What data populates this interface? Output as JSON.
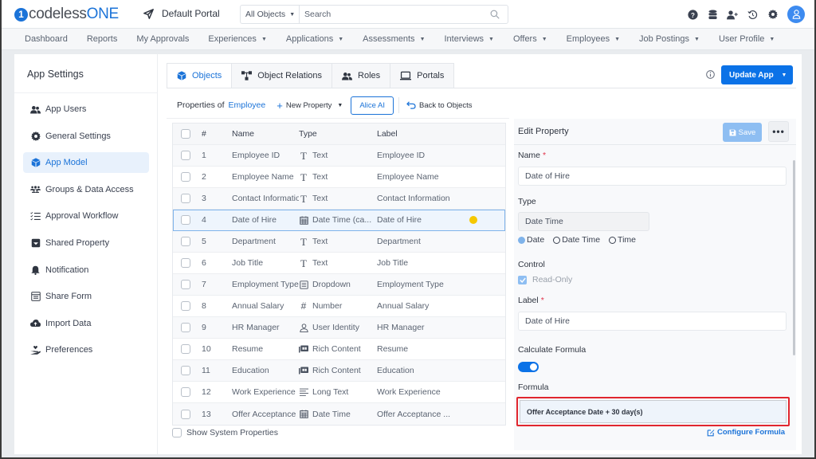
{
  "header": {
    "logo_prefix": "codeless",
    "logo_suffix": "ONE",
    "portal_name": "Default Portal",
    "search_scope": "All Objects",
    "search_placeholder": "Search",
    "icons": [
      "help-icon",
      "database-icon",
      "add-user-icon",
      "history-icon",
      "gear-icon",
      "avatar"
    ]
  },
  "nav": {
    "items": [
      {
        "label": "Dashboard",
        "dropdown": false
      },
      {
        "label": "Reports",
        "dropdown": false
      },
      {
        "label": "My Approvals",
        "dropdown": false
      },
      {
        "label": "Experiences",
        "dropdown": true
      },
      {
        "label": "Applications",
        "dropdown": true
      },
      {
        "label": "Assessments",
        "dropdown": true
      },
      {
        "label": "Interviews",
        "dropdown": true
      },
      {
        "label": "Offers",
        "dropdown": true
      },
      {
        "label": "Employees",
        "dropdown": true
      },
      {
        "label": "Job Postings",
        "dropdown": true
      },
      {
        "label": "User Profile",
        "dropdown": true
      }
    ]
  },
  "sidebar": {
    "title": "App Settings",
    "items": [
      {
        "label": "App Users",
        "icon": "users-icon",
        "active": false
      },
      {
        "label": "General Settings",
        "icon": "gear-icon",
        "active": false
      },
      {
        "label": "App Model",
        "icon": "cube-icon",
        "active": true
      },
      {
        "label": "Groups & Data Access",
        "icon": "groups-icon",
        "active": false
      },
      {
        "label": "Approval Workflow",
        "icon": "checklist-icon",
        "active": false
      },
      {
        "label": "Shared Property",
        "icon": "inbox-icon",
        "active": false
      },
      {
        "label": "Notification",
        "icon": "bell-icon",
        "active": false
      },
      {
        "label": "Share Form",
        "icon": "form-icon",
        "active": false
      },
      {
        "label": "Import Data",
        "icon": "cloud-upload-icon",
        "active": false
      },
      {
        "label": "Preferences",
        "icon": "hand-heart-icon",
        "active": false
      }
    ]
  },
  "main": {
    "tabs": [
      {
        "label": "Objects",
        "icon": "cube-icon",
        "active": true
      },
      {
        "label": "Object Relations",
        "icon": "relations-icon",
        "active": false
      },
      {
        "label": "Roles",
        "icon": "users-icon",
        "active": false
      },
      {
        "label": "Portals",
        "icon": "laptop-icon",
        "active": false
      }
    ],
    "update_button": "Update App",
    "toolbar": {
      "properties_of": "Properties of",
      "object_name": "Employee",
      "new_property": "New Property",
      "alice_ai": "Alice AI",
      "back_to_objects": "Back to Objects"
    },
    "table": {
      "columns": [
        "#",
        "Name",
        "Type",
        "Label"
      ],
      "rows": [
        {
          "num": "1",
          "name": "Employee ID",
          "type": "Text",
          "type_icon": "text",
          "label": "Employee ID"
        },
        {
          "num": "2",
          "name": "Employee Name",
          "type": "Text",
          "type_icon": "text",
          "label": "Employee Name"
        },
        {
          "num": "3",
          "name": "Contact Information",
          "type": "Text",
          "type_icon": "text",
          "label": "Contact Information"
        },
        {
          "num": "4",
          "name": "Date of Hire",
          "type": "Date Time (ca...",
          "type_icon": "calendar",
          "label": "Date of Hire",
          "selected": true,
          "modified": true
        },
        {
          "num": "5",
          "name": "Department",
          "type": "Text",
          "type_icon": "text",
          "label": "Department"
        },
        {
          "num": "6",
          "name": "Job Title",
          "type": "Text",
          "type_icon": "text",
          "label": "Job Title"
        },
        {
          "num": "7",
          "name": "Employment Type",
          "type": "Dropdown",
          "type_icon": "dropdown",
          "label": "Employment Type"
        },
        {
          "num": "8",
          "name": "Annual Salary",
          "type": "Number",
          "type_icon": "number",
          "label": "Annual Salary"
        },
        {
          "num": "9",
          "name": "HR Manager",
          "type": "User Identity",
          "type_icon": "user",
          "label": "HR Manager"
        },
        {
          "num": "10",
          "name": "Resume",
          "type": "Rich Content",
          "type_icon": "rich",
          "label": "Resume"
        },
        {
          "num": "11",
          "name": "Education",
          "type": "Rich Content",
          "type_icon": "rich",
          "label": "Education"
        },
        {
          "num": "12",
          "name": "Work Experience",
          "type": "Long Text",
          "type_icon": "longtext",
          "label": "Work Experience"
        },
        {
          "num": "13",
          "name": "Offer Acceptance ...",
          "type": "Date Time",
          "type_icon": "calendar",
          "label": "Offer Acceptance ..."
        }
      ]
    },
    "show_system_properties": "Show System Properties"
  },
  "edit_panel": {
    "title": "Edit Property",
    "save_label": "Save",
    "more_label": "•••",
    "name_label": "Name",
    "name_value": "Date of Hire",
    "type_label": "Type",
    "type_value": "Date Time",
    "type_options": [
      {
        "label": "Date",
        "selected": true
      },
      {
        "label": "Date Time",
        "selected": false
      },
      {
        "label": "Time",
        "selected": false
      }
    ],
    "control_label": "Control",
    "read_only_label": "Read-Only",
    "read_only_checked": true,
    "label_label": "Label",
    "label_value": "Date of Hire",
    "calculate_formula_label": "Calculate Formula",
    "calculate_formula_on": true,
    "formula_label": "Formula",
    "formula_value": "Offer Acceptance Date + 30 day(s)",
    "configure_formula": "Configure Formula"
  },
  "colors": {
    "accent": "#1b73d8",
    "primary_button": "#0b72e7",
    "highlight_border": "#e0262e",
    "modified_dot": "#f5c800"
  }
}
